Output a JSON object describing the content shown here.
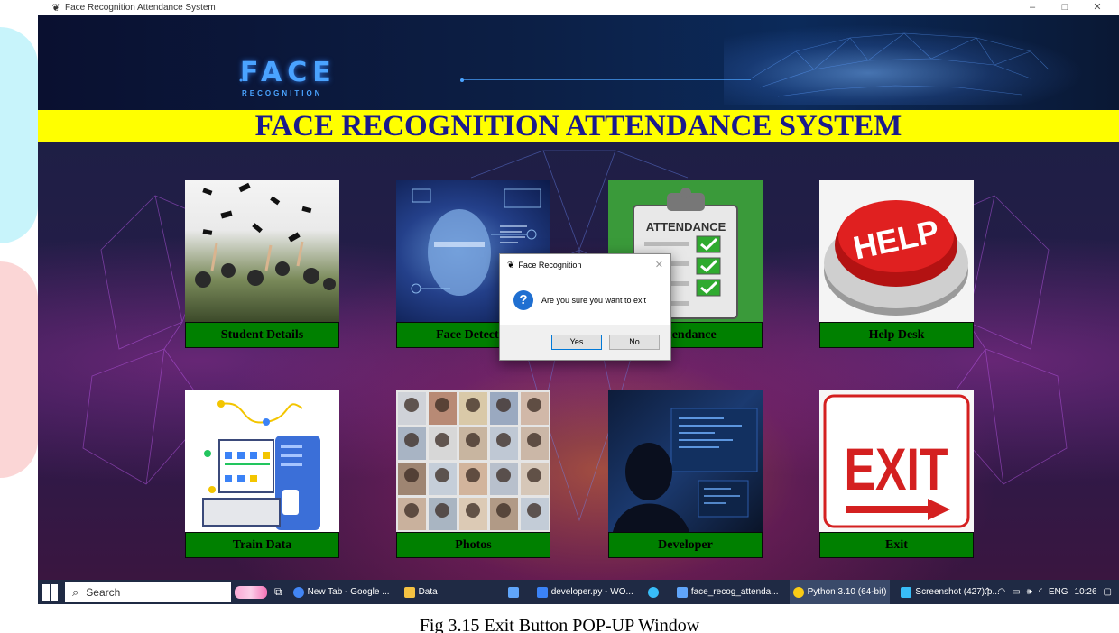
{
  "window": {
    "title": "Face Recognition Attendance System",
    "controls": [
      "–",
      "□",
      "✕"
    ]
  },
  "banner": {
    "logo_text": "FACE",
    "logo_subtext": "RECOGNITION"
  },
  "heading": "FACE RECOGNITION ATTENDANCE SYSTEM",
  "tiles": [
    {
      "label": "Student Details",
      "icon": "graduation-caps-image"
    },
    {
      "label": "Face Detector",
      "icon": "face-scan-image"
    },
    {
      "label": "Attendance",
      "icon": "attendance-clipboard-image"
    },
    {
      "label": "Help Desk",
      "icon": "help-button-image"
    },
    {
      "label": "Train Data",
      "icon": "train-data-illustration"
    },
    {
      "label": "Photos",
      "icon": "photo-grid-image"
    },
    {
      "label": "Developer",
      "icon": "developer-image"
    },
    {
      "label": "Exit",
      "icon": "exit-sign-image"
    }
  ],
  "tile_images": {
    "attendance_text": "ATTENDANCE",
    "help_text": "HELP",
    "exit_text": "EXIT"
  },
  "dialog": {
    "title": "Face Recognition",
    "message": "Are you sure you want to exit",
    "yes_label": "Yes",
    "no_label": "No"
  },
  "taskbar": {
    "search_placeholder": "Search",
    "apps": [
      {
        "label": "New Tab - Google ...",
        "color": "#4285f4"
      },
      {
        "label": "Data",
        "color": "#f5c242"
      },
      {
        "label": "developer.py - WO...",
        "color": "#3b82f6"
      },
      {
        "label": "face_recog_attenda...",
        "color": "#60a5fa"
      },
      {
        "label": "Python 3.10 (64-bit)",
        "color": "#facc15"
      },
      {
        "label": "Screenshot (427).p...",
        "color": "#38bdf8"
      }
    ],
    "tray": {
      "lang": "ENG",
      "time": "10:26"
    }
  },
  "caption": "Fig 3.15 Exit Button POP-UP Window"
}
